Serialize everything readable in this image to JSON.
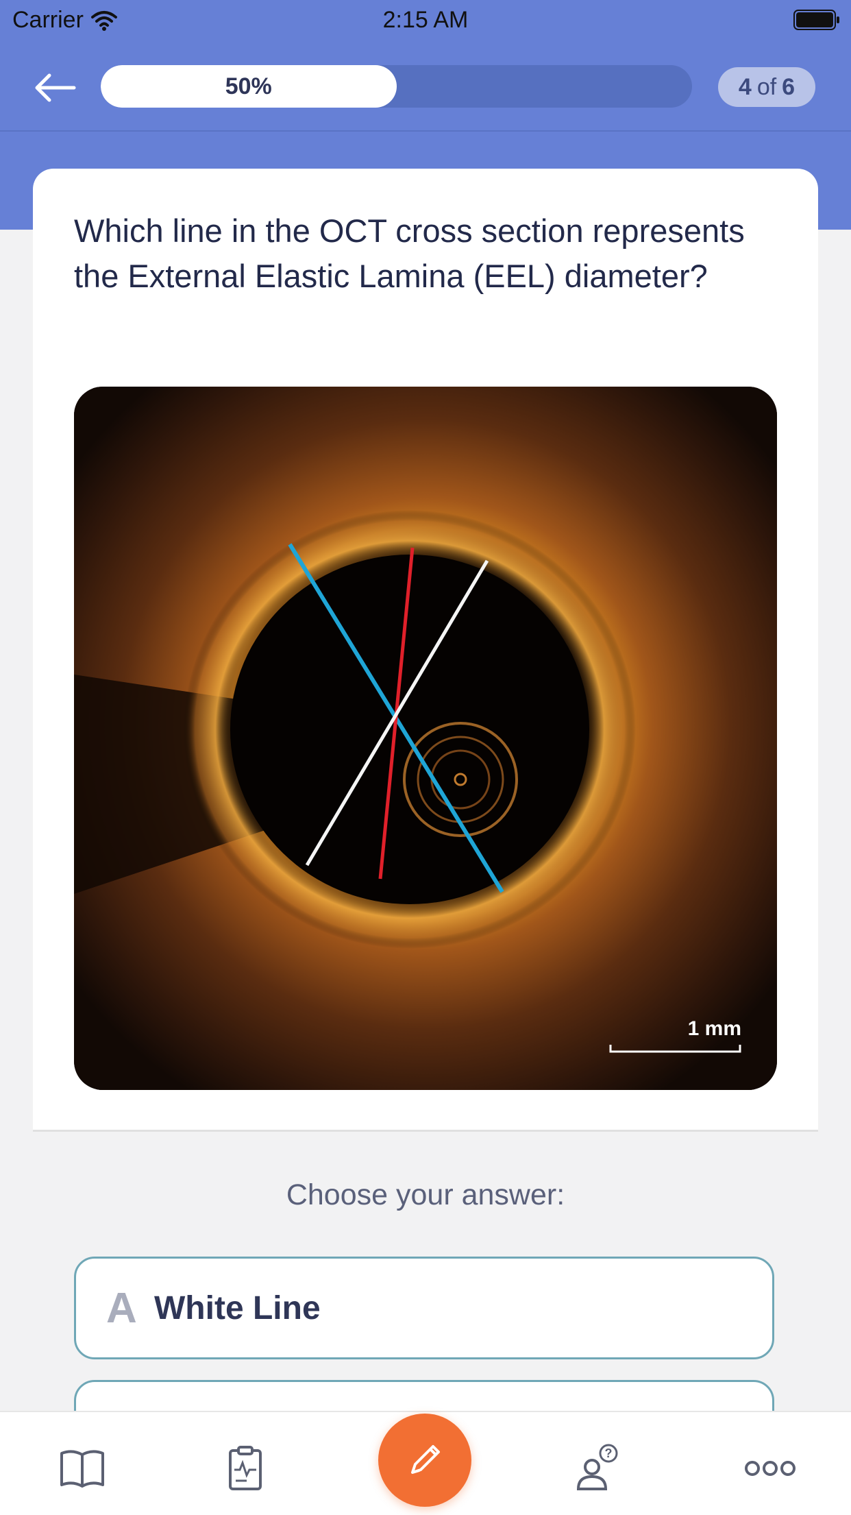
{
  "status_bar": {
    "carrier": "Carrier",
    "time": "2:15 AM"
  },
  "progress": {
    "label": "50%",
    "value": 0.5
  },
  "counter": {
    "current": "4",
    "of": "of",
    "total": "6"
  },
  "question": {
    "text": "Which line in the OCT cross section represents the External Elastic Lamina (EEL) diameter?"
  },
  "image": {
    "scale_label": "1 mm"
  },
  "answers": {
    "prompt": "Choose your answer:",
    "options": [
      {
        "letter": "A",
        "text": "White Line"
      }
    ]
  },
  "tab_bar": {
    "icons": [
      "book-icon",
      "clipboard-icon",
      "pencil-icon",
      "help-person-icon",
      "more-icon"
    ]
  },
  "colors": {
    "header": "#6680d6",
    "fab": "#f26f33",
    "answer_border": "#6fa7b6",
    "line_blue": "#1fa5d6",
    "line_red": "#e0202a",
    "line_white": "#f5f5f5"
  }
}
